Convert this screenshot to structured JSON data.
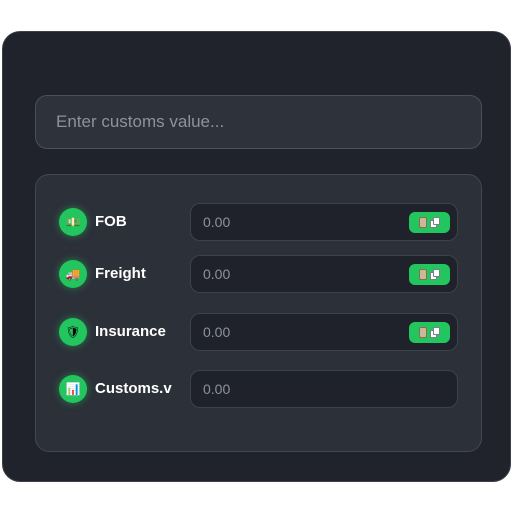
{
  "search": {
    "placeholder": "Enter customs value..."
  },
  "rows": [
    {
      "label": "FOB",
      "icon": "money-icon",
      "glyph": "💵",
      "placeholder": "0.00",
      "has_copy": true
    },
    {
      "label": "Freight",
      "icon": "truck-icon",
      "glyph": "🚚",
      "placeholder": "0.00",
      "has_copy": true
    },
    {
      "label": "Insurance",
      "icon": "shield-icon",
      "glyph": "🛡",
      "placeholder": "0.00",
      "has_copy": true
    },
    {
      "label": "Customs.v",
      "icon": "chart-icon",
      "glyph": "📊",
      "placeholder": "0.00",
      "has_copy": false
    }
  ],
  "colors": {
    "accent": "#22c55e",
    "card": "#20232b",
    "panel": "#2c3039"
  }
}
